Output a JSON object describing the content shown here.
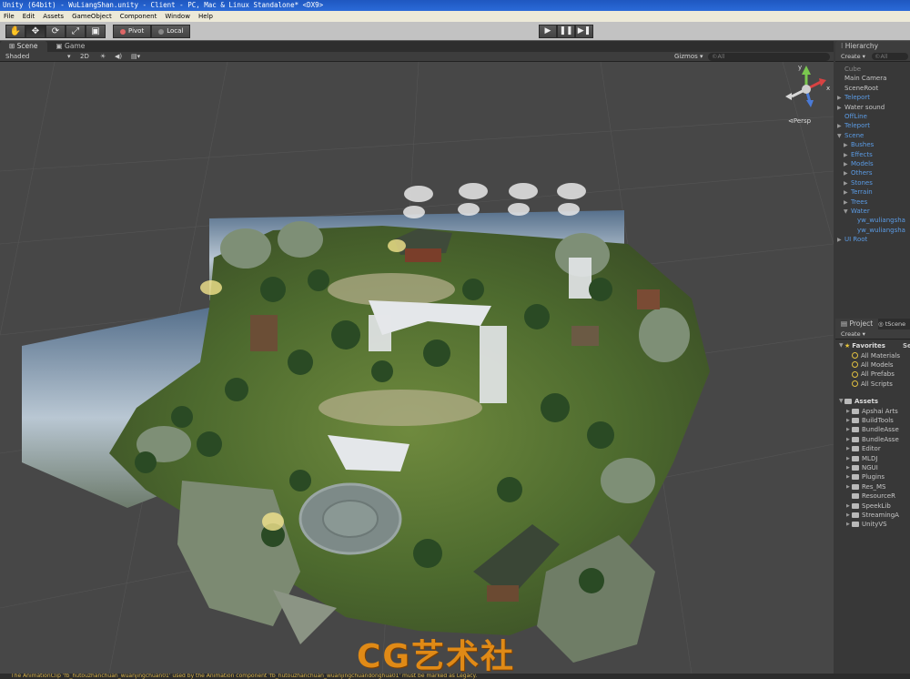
{
  "window": {
    "title": "Unity (64bit) - WuLiangShan.unity - Client - PC, Mac & Linux Standalone* <DX9>"
  },
  "menu": [
    "File",
    "Edit",
    "Assets",
    "GameObject",
    "Component",
    "Window",
    "Help"
  ],
  "toolbar": {
    "tools": [
      "hand-icon",
      "move-icon",
      "rotate-icon",
      "scale-icon",
      "rect-icon"
    ],
    "pivot_label": "Pivot",
    "local_label": "Local",
    "play": [
      "▶",
      "❚❚",
      "▶❚"
    ]
  },
  "scene": {
    "tabs": [
      "Scene",
      "Game"
    ],
    "shading": "Shaded",
    "mode_2d": "2D",
    "gizmos": "Gizmos ▾",
    "search_placeholder": "©All",
    "projection": "Persp",
    "watermark": "CG艺术社",
    "gizmo_axis_y": "y",
    "gizmo_axis_x": "x"
  },
  "hierarchy": {
    "tab": "Hierarchy",
    "create": "Create ▾",
    "search": "©All",
    "items": [
      {
        "label": "Cube",
        "style": "grey",
        "indent": 0,
        "arrow": ""
      },
      {
        "label": "Main Camera",
        "style": "",
        "indent": 0,
        "arrow": ""
      },
      {
        "label": "SceneRoot",
        "style": "",
        "indent": 0,
        "arrow": ""
      },
      {
        "label": "Teleport",
        "style": "blue",
        "indent": 0,
        "arrow": "▶"
      },
      {
        "label": "Water sound",
        "style": "",
        "indent": 0,
        "arrow": "▶"
      },
      {
        "label": "OffLine",
        "style": "blue",
        "indent": 0,
        "arrow": ""
      },
      {
        "label": "Teleport",
        "style": "blue",
        "indent": 0,
        "arrow": "▶"
      },
      {
        "label": "Scene",
        "style": "blue",
        "indent": 0,
        "arrow": "▼"
      },
      {
        "label": "Bushes",
        "style": "blue",
        "indent": 1,
        "arrow": "▶"
      },
      {
        "label": "Effects",
        "style": "blue",
        "indent": 1,
        "arrow": "▶"
      },
      {
        "label": "Models",
        "style": "blue",
        "indent": 1,
        "arrow": "▶"
      },
      {
        "label": "Others",
        "style": "blue",
        "indent": 1,
        "arrow": "▶"
      },
      {
        "label": "Stones",
        "style": "blue",
        "indent": 1,
        "arrow": "▶"
      },
      {
        "label": "Terrain",
        "style": "blue",
        "indent": 1,
        "arrow": "▶"
      },
      {
        "label": "Trees",
        "style": "blue",
        "indent": 1,
        "arrow": "▶"
      },
      {
        "label": "Water",
        "style": "blue",
        "indent": 1,
        "arrow": "▼"
      },
      {
        "label": "yw_wuliangsha",
        "style": "blue",
        "indent": 2,
        "arrow": ""
      },
      {
        "label": "yw_wuliangsha",
        "style": "blue",
        "indent": 2,
        "arrow": ""
      },
      {
        "label": "UI Root",
        "style": "blue",
        "indent": 0,
        "arrow": "▶"
      }
    ]
  },
  "project": {
    "tab": "Project",
    "tab2": "tScene",
    "create": "Create ▾",
    "favorites_label": "Favorites",
    "favorites": [
      "All Materials",
      "All Models",
      "All Prefabs",
      "All Scripts"
    ],
    "assets_label": "Assets",
    "assets": [
      {
        "label": "Apshai Arts",
        "arrow": "▶"
      },
      {
        "label": "BuildTools",
        "arrow": "▶"
      },
      {
        "label": "BundleAsse",
        "arrow": "▶"
      },
      {
        "label": "BundleAsse",
        "arrow": "▶"
      },
      {
        "label": "Editor",
        "arrow": "▶"
      },
      {
        "label": "MLDJ",
        "arrow": "▶"
      },
      {
        "label": "NGUI",
        "arrow": "▶"
      },
      {
        "label": "Plugins",
        "arrow": "▶"
      },
      {
        "label": "Res_MS",
        "arrow": "▶"
      },
      {
        "label": "ResourceR",
        "arrow": ""
      },
      {
        "label": "SpeekLib",
        "arrow": "▶"
      },
      {
        "label": "StreamingA",
        "arrow": "▶"
      },
      {
        "label": "UnityVS",
        "arrow": "▶"
      }
    ],
    "col2": "Se"
  },
  "status": {
    "message": "The AnimationClip 'fb_hutouzhanchuan_wuanjingchuan01' used by the Animation component 'fb_hutouzhanchuan_wuanjingchuandonghua01' must be marked as Legacy."
  },
  "colors": {
    "selection_blue": "#5b9be4",
    "watermark": "#e08a16",
    "viewport_bg": "#474747"
  }
}
